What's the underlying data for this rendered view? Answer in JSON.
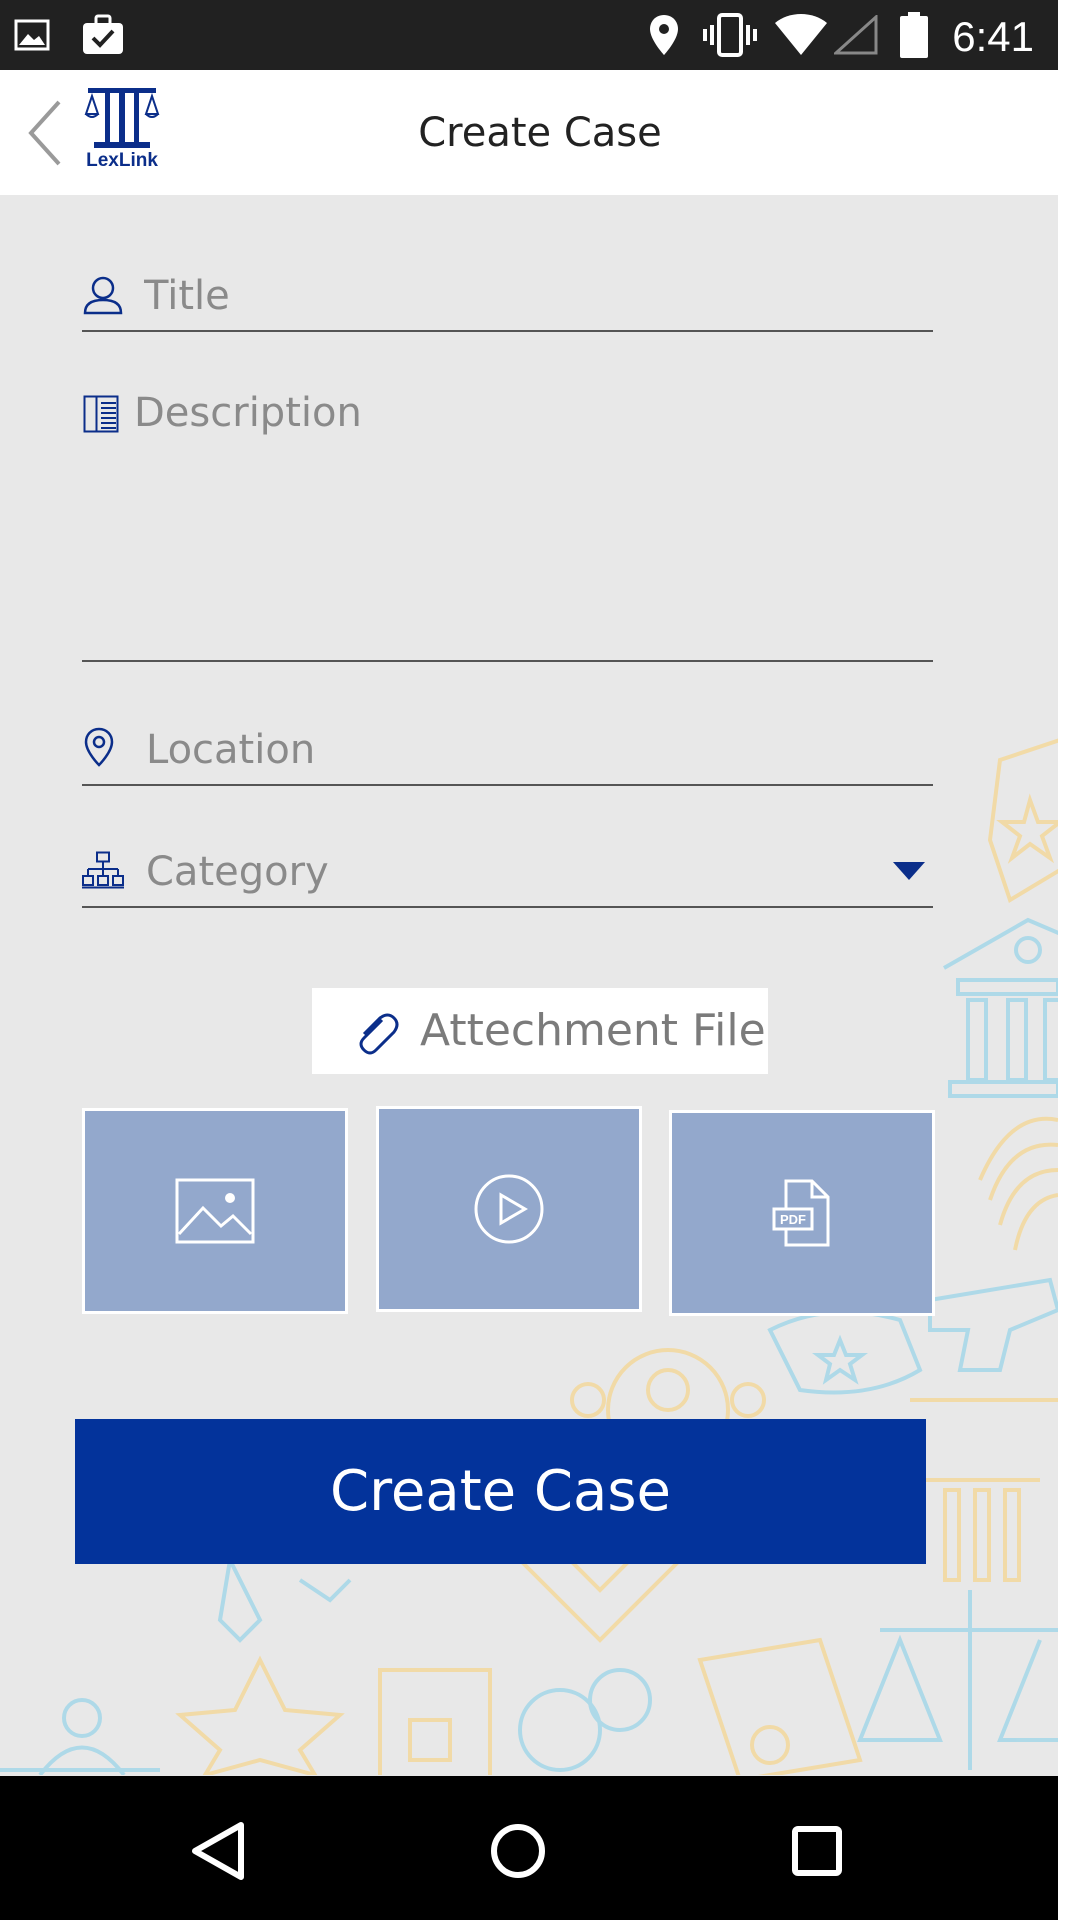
{
  "status_bar": {
    "time": "6:41",
    "icons": [
      "image-notification-icon",
      "briefcase-check-icon",
      "location-icon",
      "vibrate-icon",
      "wifi-icon",
      "signal-icon",
      "battery-icon"
    ]
  },
  "app_bar": {
    "title": "Create Case",
    "logo_text": "LexLink",
    "back_icon": "chevron-left-icon"
  },
  "form": {
    "title_placeholder": "Title",
    "description_placeholder": "Description",
    "location_placeholder": "Location",
    "category_placeholder": "Category"
  },
  "attachment": {
    "label": "Attechment File",
    "tiles": [
      "image-icon",
      "play-icon",
      "pdf-icon"
    ]
  },
  "submit": {
    "label": "Create Case"
  },
  "colors": {
    "primary": "#03339b",
    "tile": "#93a8cc",
    "background": "#e8e8e8",
    "deco_yellow": "#f3d9a0",
    "deco_blue": "#a8d8e8"
  },
  "nav_bar": {
    "buttons": [
      "back-triangle-icon",
      "home-circle-icon",
      "recents-square-icon"
    ]
  }
}
